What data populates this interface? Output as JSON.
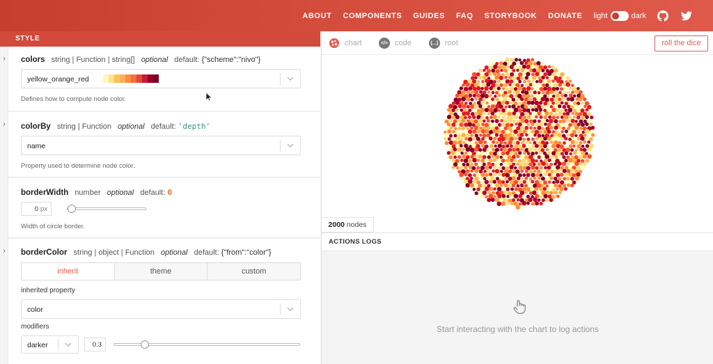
{
  "nav": {
    "links": [
      "ABOUT",
      "COMPONENTS",
      "GUIDES",
      "FAQ",
      "STORYBOOK",
      "DONATE"
    ],
    "theme_light": "light",
    "theme_dark": "dark",
    "icons": [
      "github-icon",
      "twitter-icon"
    ]
  },
  "panel": {
    "title": "STYLE"
  },
  "props": {
    "colors": {
      "name": "colors",
      "type": "string | Function | string[]",
      "optional": "optional",
      "default_label": "default:",
      "default_value": "{\"scheme\":\"nivo\"}",
      "select_value": "yellow_orange_red",
      "swatch_colors": [
        "#fff7bc",
        "#fee391",
        "#fec44f",
        "#fdae61",
        "#fb8d3c",
        "#f46d43",
        "#e34a33",
        "#c51b3a",
        "#99001f",
        "#7a0025"
      ],
      "description": "Defines how to compute node color."
    },
    "colorBy": {
      "name": "colorBy",
      "type": "string | Function",
      "optional": "optional",
      "default_label": "default:",
      "default_value": "'depth'",
      "select_value": "name",
      "description": "Property used to determine node color."
    },
    "borderWidth": {
      "name": "borderWidth",
      "type": "number",
      "optional": "optional",
      "default_label": "default:",
      "default_value": "0",
      "input_value": "0",
      "unit": "px",
      "slider_level": 0,
      "description": "Width of circle border."
    },
    "borderColor": {
      "name": "borderColor",
      "type": "string | object | Function",
      "optional": "optional",
      "default_label": "default:",
      "default_value": "{\"from\":\"color\"}",
      "tabs": [
        "inherit",
        "theme",
        "custom"
      ],
      "active_tab": "inherit",
      "inherited_label": "inherited property",
      "inherited_value": "color",
      "modifiers_label": "modifiers",
      "modifier_type": "darker",
      "modifier_value": "0.3",
      "modifier_level": 0.15
    }
  },
  "preview": {
    "tabs": [
      "chart",
      "code",
      "root"
    ],
    "active_tab": "chart",
    "code_icon_text": "</>",
    "root_icon_text": "{...}",
    "dice_label": "roll the dice",
    "nodes_count": "2000",
    "nodes_label": "nodes",
    "colors": [
      "#ffffb2",
      "#fed976",
      "#feb24c",
      "#fd8d3c",
      "#fc4e2a",
      "#e31a1c",
      "#b10026",
      "#800026"
    ]
  },
  "logs": {
    "title": "ACTIONS LOGS",
    "empty_message": "Start interacting with the chart to log actions"
  }
}
